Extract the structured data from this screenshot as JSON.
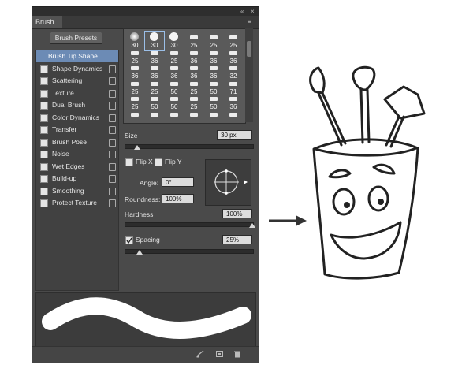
{
  "panel": {
    "tab_title": "Brush",
    "collapse_glyph": "«",
    "close_glyph": "×",
    "menu_glyph": "≡",
    "presets_button": "Brush Presets"
  },
  "options": [
    {
      "label": "Brush Tip Shape",
      "selected": true,
      "checkbox": false,
      "lock": false
    },
    {
      "label": "Shape Dynamics",
      "checkbox": true,
      "lock": true
    },
    {
      "label": "Scattering",
      "checkbox": true,
      "lock": true
    },
    {
      "label": "Texture",
      "checkbox": true,
      "lock": true
    },
    {
      "label": "Dual Brush",
      "checkbox": true,
      "lock": true
    },
    {
      "label": "Color Dynamics",
      "checkbox": true,
      "lock": true
    },
    {
      "label": "Transfer",
      "checkbox": true,
      "lock": true
    },
    {
      "label": "Brush Pose",
      "checkbox": true,
      "lock": true
    },
    {
      "label": "Noise",
      "checkbox": true,
      "lock": true
    },
    {
      "label": "Wet Edges",
      "checkbox": true,
      "lock": true
    },
    {
      "label": "Build-up",
      "checkbox": true,
      "lock": true
    },
    {
      "label": "Smoothing",
      "checkbox": true,
      "lock": true
    },
    {
      "label": "Protect Texture",
      "checkbox": true,
      "lock": true
    }
  ],
  "brush_rows": [
    [
      "30",
      "30",
      "30",
      "25",
      "25",
      "25"
    ],
    [
      "25",
      "36",
      "25",
      "36",
      "36",
      "36"
    ],
    [
      "36",
      "36",
      "36",
      "36",
      "36",
      "32"
    ],
    [
      "25",
      "25",
      "50",
      "25",
      "50",
      "71"
    ],
    [
      "25",
      "50",
      "50",
      "25",
      "50",
      "36"
    ],
    [
      "",
      "",
      "",
      "",
      "",
      ""
    ]
  ],
  "selected_brush": 1,
  "controls": {
    "size_label": "Size",
    "size_value": "30 px",
    "size_level": 0.1,
    "flip_x": "Flip X",
    "flip_y": "Flip Y",
    "angle_label": "Angle:",
    "angle_value": "0°",
    "roundness_label": "Roundness:",
    "roundness_value": "100%",
    "hardness_label": "Hardness",
    "hardness_value": "100%",
    "hardness_level": 1.0,
    "spacing_label": "Spacing",
    "spacing_checked": true,
    "spacing_value": "25%",
    "spacing_level": 0.12
  },
  "colors": {
    "panel_bg": "#4a4a4a",
    "selected_item": "#6c8bb5",
    "stroke": "#ffffff"
  },
  "bottom_icons": [
    "toggle-brush-icon",
    "new-preset-icon",
    "delete-icon"
  ],
  "illustration": {
    "arrow": "arrow-right-icon",
    "drawing": "cartoon-brush-cup"
  }
}
